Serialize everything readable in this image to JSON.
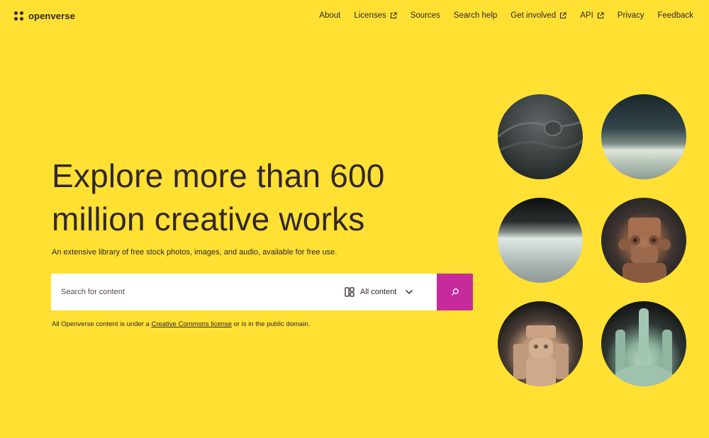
{
  "brand": {
    "name": "openverse"
  },
  "nav": {
    "items": [
      {
        "label": "About",
        "external": false
      },
      {
        "label": "Licenses",
        "external": true
      },
      {
        "label": "Sources",
        "external": false
      },
      {
        "label": "Search help",
        "external": false
      },
      {
        "label": "Get involved",
        "external": true
      },
      {
        "label": "API",
        "external": true
      },
      {
        "label": "Privacy",
        "external": false
      },
      {
        "label": "Feedback",
        "external": false
      }
    ]
  },
  "hero": {
    "headline_line1": "Explore more than 600",
    "headline_line2": "million creative works",
    "subtitle": "An extensive library of free stock photos, images, and audio, available for free use."
  },
  "search": {
    "placeholder": "Search for content",
    "content_type": "All content",
    "notice_before": "All Openverse content is under a ",
    "notice_link": "Creative Commons license",
    "notice_after": " or is in the public domain."
  },
  "colors": {
    "background": "#ffe033",
    "text": "#30272e",
    "search_button": "#c52b9b"
  },
  "icons": [
    "openverse-logo-icon",
    "external-link-icon",
    "content-type-icon",
    "chevron-down-icon",
    "search-icon"
  ]
}
